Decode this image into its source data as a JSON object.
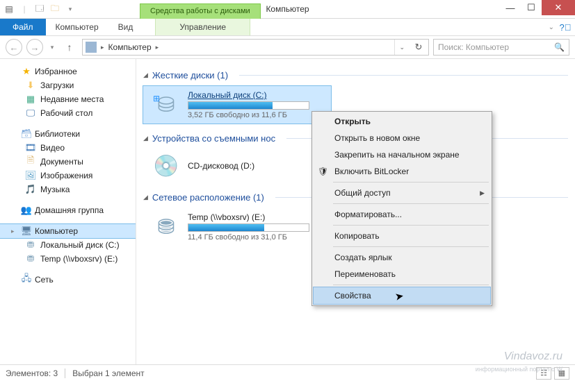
{
  "window": {
    "title": "Компьютер",
    "context_tab": "Средства работы с дисками"
  },
  "ribbon": {
    "file": "Файл",
    "tabs": [
      "Компьютер",
      "Вид"
    ],
    "context": "Управление"
  },
  "nav": {
    "breadcrumb": "Компьютер",
    "search_placeholder": "Поиск: Компьютер"
  },
  "sidebar": {
    "favorites": {
      "label": "Избранное",
      "items": [
        {
          "icon": "download",
          "label": "Загрузки"
        },
        {
          "icon": "recent",
          "label": "Недавние места"
        },
        {
          "icon": "desktop",
          "label": "Рабочий стол"
        }
      ]
    },
    "libraries": {
      "label": "Библиотеки",
      "items": [
        {
          "icon": "video",
          "label": "Видео"
        },
        {
          "icon": "doc",
          "label": "Документы"
        },
        {
          "icon": "img",
          "label": "Изображения"
        },
        {
          "icon": "music",
          "label": "Музыка"
        }
      ]
    },
    "homegroup": {
      "label": "Домашняя группа"
    },
    "computer": {
      "label": "Компьютер",
      "items": [
        {
          "icon": "drive",
          "label": "Локальный диск (C:)"
        },
        {
          "icon": "netdrive",
          "label": "Temp (\\\\vboxsrv) (E:)"
        }
      ]
    },
    "network": {
      "label": "Сеть"
    }
  },
  "groups": {
    "hdd": {
      "label": "Жесткие диски (1)"
    },
    "removable": {
      "label": "Устройства со съемными нос"
    },
    "network": {
      "label": "Сетевое расположение (1)"
    }
  },
  "drives": {
    "c": {
      "name": "Локальный диск (C:)",
      "free_text": "3,52 ГБ свободно из 11,6 ГБ",
      "fill_pct": 70
    },
    "cd": {
      "name": "CD-дисковод (D:)"
    },
    "net": {
      "name": "Temp (\\\\vboxsrv) (E:)",
      "free_text": "11,4 ГБ свободно из 31,0 ГБ",
      "fill_pct": 63
    }
  },
  "context_menu": {
    "items": [
      {
        "label": "Открыть",
        "first": true
      },
      {
        "label": "Открыть в новом окне"
      },
      {
        "label": "Закрепить на начальном экране"
      },
      {
        "label": "Включить BitLocker",
        "shield": true
      },
      {
        "sep": true
      },
      {
        "label": "Общий доступ",
        "submenu": true
      },
      {
        "sep": true
      },
      {
        "label": "Форматировать..."
      },
      {
        "sep": true
      },
      {
        "label": "Копировать"
      },
      {
        "sep": true
      },
      {
        "label": "Создать ярлык"
      },
      {
        "label": "Переименовать"
      },
      {
        "sep": true
      },
      {
        "label": "Свойства",
        "hover": true
      }
    ]
  },
  "status": {
    "count": "Элементов: 3",
    "selected": "Выбран 1 элемент"
  },
  "watermark": {
    "line1": "Vindavoz.ru",
    "line2": "информационный портал о W"
  }
}
